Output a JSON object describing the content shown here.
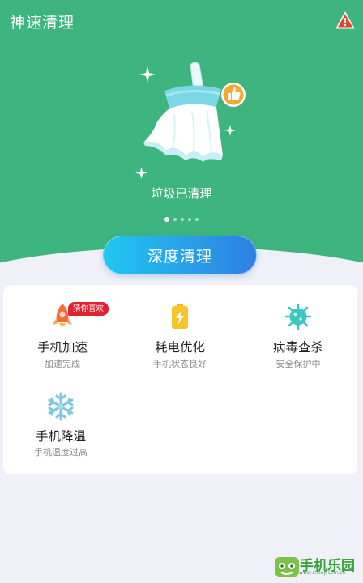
{
  "header": {
    "title": "神速清理",
    "warning_icon": "warning-triangle-icon"
  },
  "hero": {
    "illustration": "broom-icon",
    "thumb_icon": "thumbs-up-icon",
    "status": "垃圾已清理",
    "carousel_pages": 5,
    "carousel_active": 1,
    "deep_clean_label": "深度清理"
  },
  "features": [
    {
      "name": "手机加速",
      "sub": "加速完成",
      "icon": "rocket-icon",
      "badge": "猜你喜欢"
    },
    {
      "name": "耗电优化",
      "sub": "手机状态良好",
      "icon": "battery-icon"
    },
    {
      "name": "病毒查杀",
      "sub": "安全保护中",
      "icon": "virus-icon"
    },
    {
      "name": "手机降温",
      "sub": "手机温度过高",
      "icon": "snowflake-icon"
    }
  ],
  "watermark": {
    "text": "手机乐园",
    "url": "www.shouji.com.cn"
  },
  "colors": {
    "hero_green": "#3eb47f",
    "button_start": "#20c7f0",
    "button_end": "#2f7fe3",
    "badge_red": "#e1212f"
  }
}
